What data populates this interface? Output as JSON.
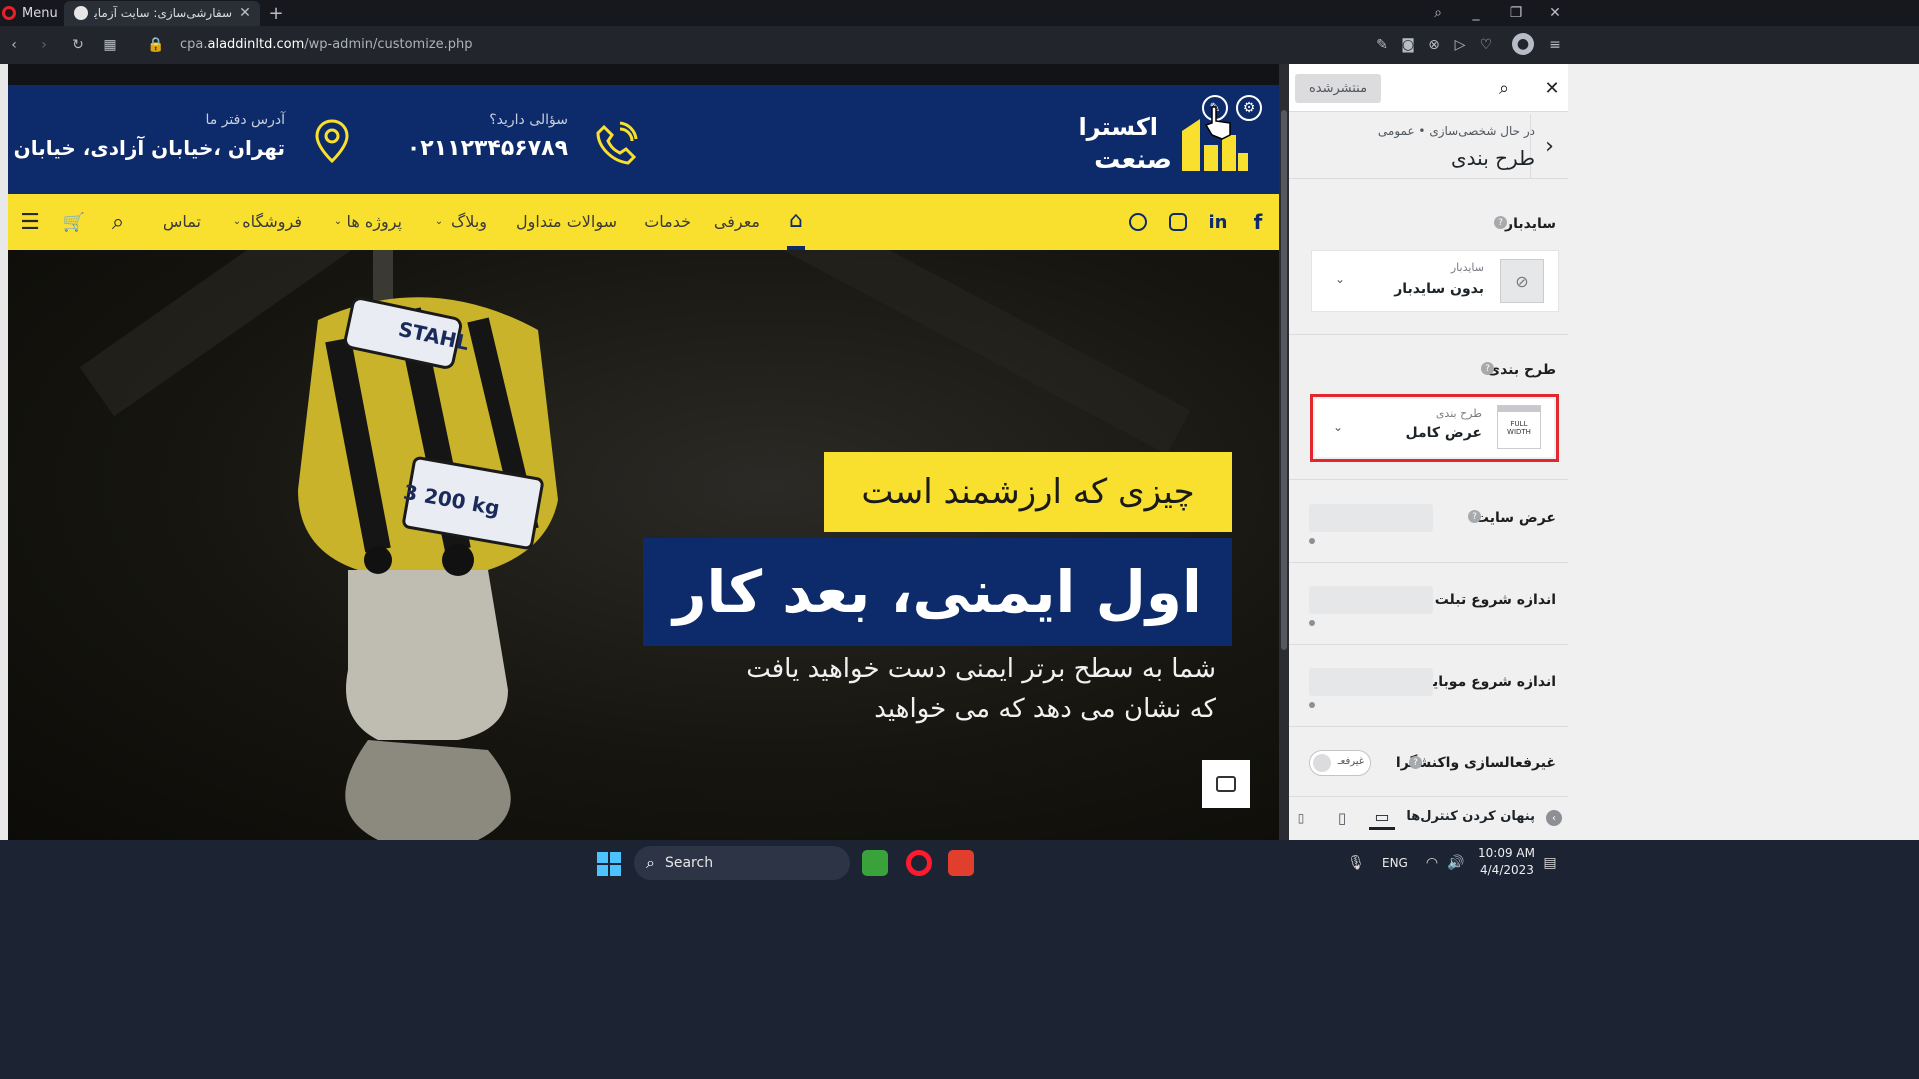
{
  "browser": {
    "menu_label": "Menu",
    "tab_title": "سفارشی‌سازی: سایت آزمایشی علاءالدین",
    "url_prefix": "cpa.",
    "url_domain": "aladdinltd.com",
    "url_path": "/wp-admin/customize.php"
  },
  "site": {
    "logo_line1": "اکسترا",
    "logo_line2": "صنعت",
    "phone_label": "سؤالی دارید؟",
    "phone_number": "۰۲۱۱۲۳۴۵۶۷۸۹",
    "address_label": "آدرس دفتر ما",
    "address_value": "تهران ،خیابان آزادی، خیابان بهبودی",
    "nav": {
      "home": "⌂",
      "intro": "معرفی",
      "services": "خدمات",
      "faq": "سوالات متداول",
      "blog": "وبلاگ",
      "projects": "پروژه ها",
      "shop": "فروشگاه",
      "contact": "تماس"
    },
    "hero": {
      "kicker": "چیزی که ارزشمند است",
      "headline": "اول ایمنی، بعد کار",
      "sub1": "شما به سطح برتر ایمنی دست خواهید یافت",
      "sub2": "که نشان می دهد که می خواهید",
      "hook_brand": "STAHL",
      "hook_capacity": "3 200 kg"
    }
  },
  "customizer": {
    "published_button": "منتشرشده",
    "breadcrumb": "در حال شخصی‌سازی • عمومی",
    "section_title": "طرح بندی",
    "sidebar_heading": "سایدبار",
    "sidebar_select_label": "سایدبار",
    "sidebar_select_value": "بدون سایدبار",
    "layout_heading": "طرح بندی",
    "layout_select_label": "طرح بندی",
    "layout_select_value": "عرض کامل",
    "layout_thumb_text1": "FULL",
    "layout_thumb_text2": "WIDTH",
    "site_width_label": "عرض سایت",
    "tablet_label": "اندازه شروع تبلت",
    "mobile_label": "اندازه شروع موبایل",
    "responsive_label": "غیرفعالسازی واکنشگرا",
    "toggle_text": "غیرفعـ",
    "hide_controls": "پنهان کردن کنترل‌ها"
  },
  "taskbar": {
    "search_placeholder": "Search",
    "lang": "ENG",
    "time": "10:09 AM",
    "date": "4/4/2023"
  },
  "colors": {
    "brand_blue": "#0d2a6b",
    "brand_yellow": "#f9e02e",
    "highlight_red": "#e0282e"
  }
}
